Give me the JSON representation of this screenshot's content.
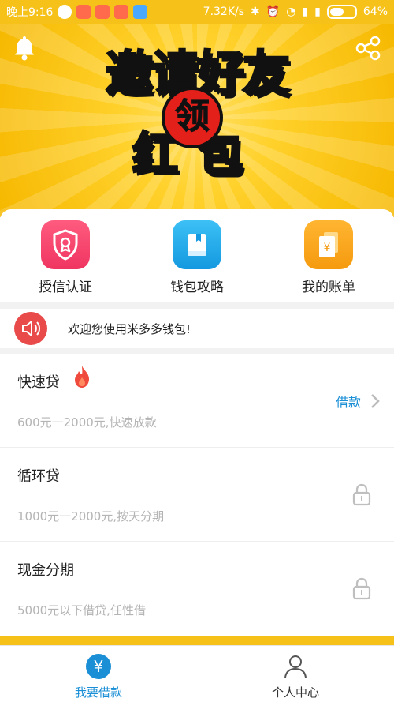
{
  "status_bar": {
    "time_text": "晚上9:16",
    "net_speed": "7.32K/s",
    "battery_text": "64%",
    "battery_level": 0.64
  },
  "banner": {
    "headline_line1": "邀请好友",
    "headline_badge": "领",
    "headline_line2": "红包",
    "icons": [
      "bell-icon",
      "share-icon"
    ]
  },
  "quick_actions": [
    {
      "label": "授信认证",
      "icon": "shield-ribbon-icon",
      "color": "#f0436a"
    },
    {
      "label": "钱包攻略",
      "icon": "book-icon",
      "color": "#19a9ea"
    },
    {
      "label": "我的账单",
      "icon": "bill-yuan-icon",
      "color": "#f7a21b"
    }
  ],
  "notice": {
    "text": "欢迎您使用米多多钱包!",
    "icon": "speaker-icon",
    "color": "#e94a4a"
  },
  "loans": [
    {
      "title": "快速贷",
      "subtitle": "600元一2000元,快速放款",
      "action": "借款",
      "hot": true,
      "locked": false
    },
    {
      "title": "循环贷",
      "subtitle": "1000元一2000元,按天分期",
      "locked": true
    },
    {
      "title": "现金分期",
      "subtitle": "5000元以下借贷,任性借",
      "locked": true
    }
  ],
  "tab_bar": {
    "tabs": [
      {
        "label": "我要借款",
        "icon": "yuan-icon",
        "active": true
      },
      {
        "label": "个人中心",
        "icon": "person-icon",
        "active": false
      }
    ],
    "active_color": "#1a8fd6"
  },
  "colors": {
    "brand_yellow": "#f6c21a",
    "accent_blue": "#1a8fd6"
  }
}
